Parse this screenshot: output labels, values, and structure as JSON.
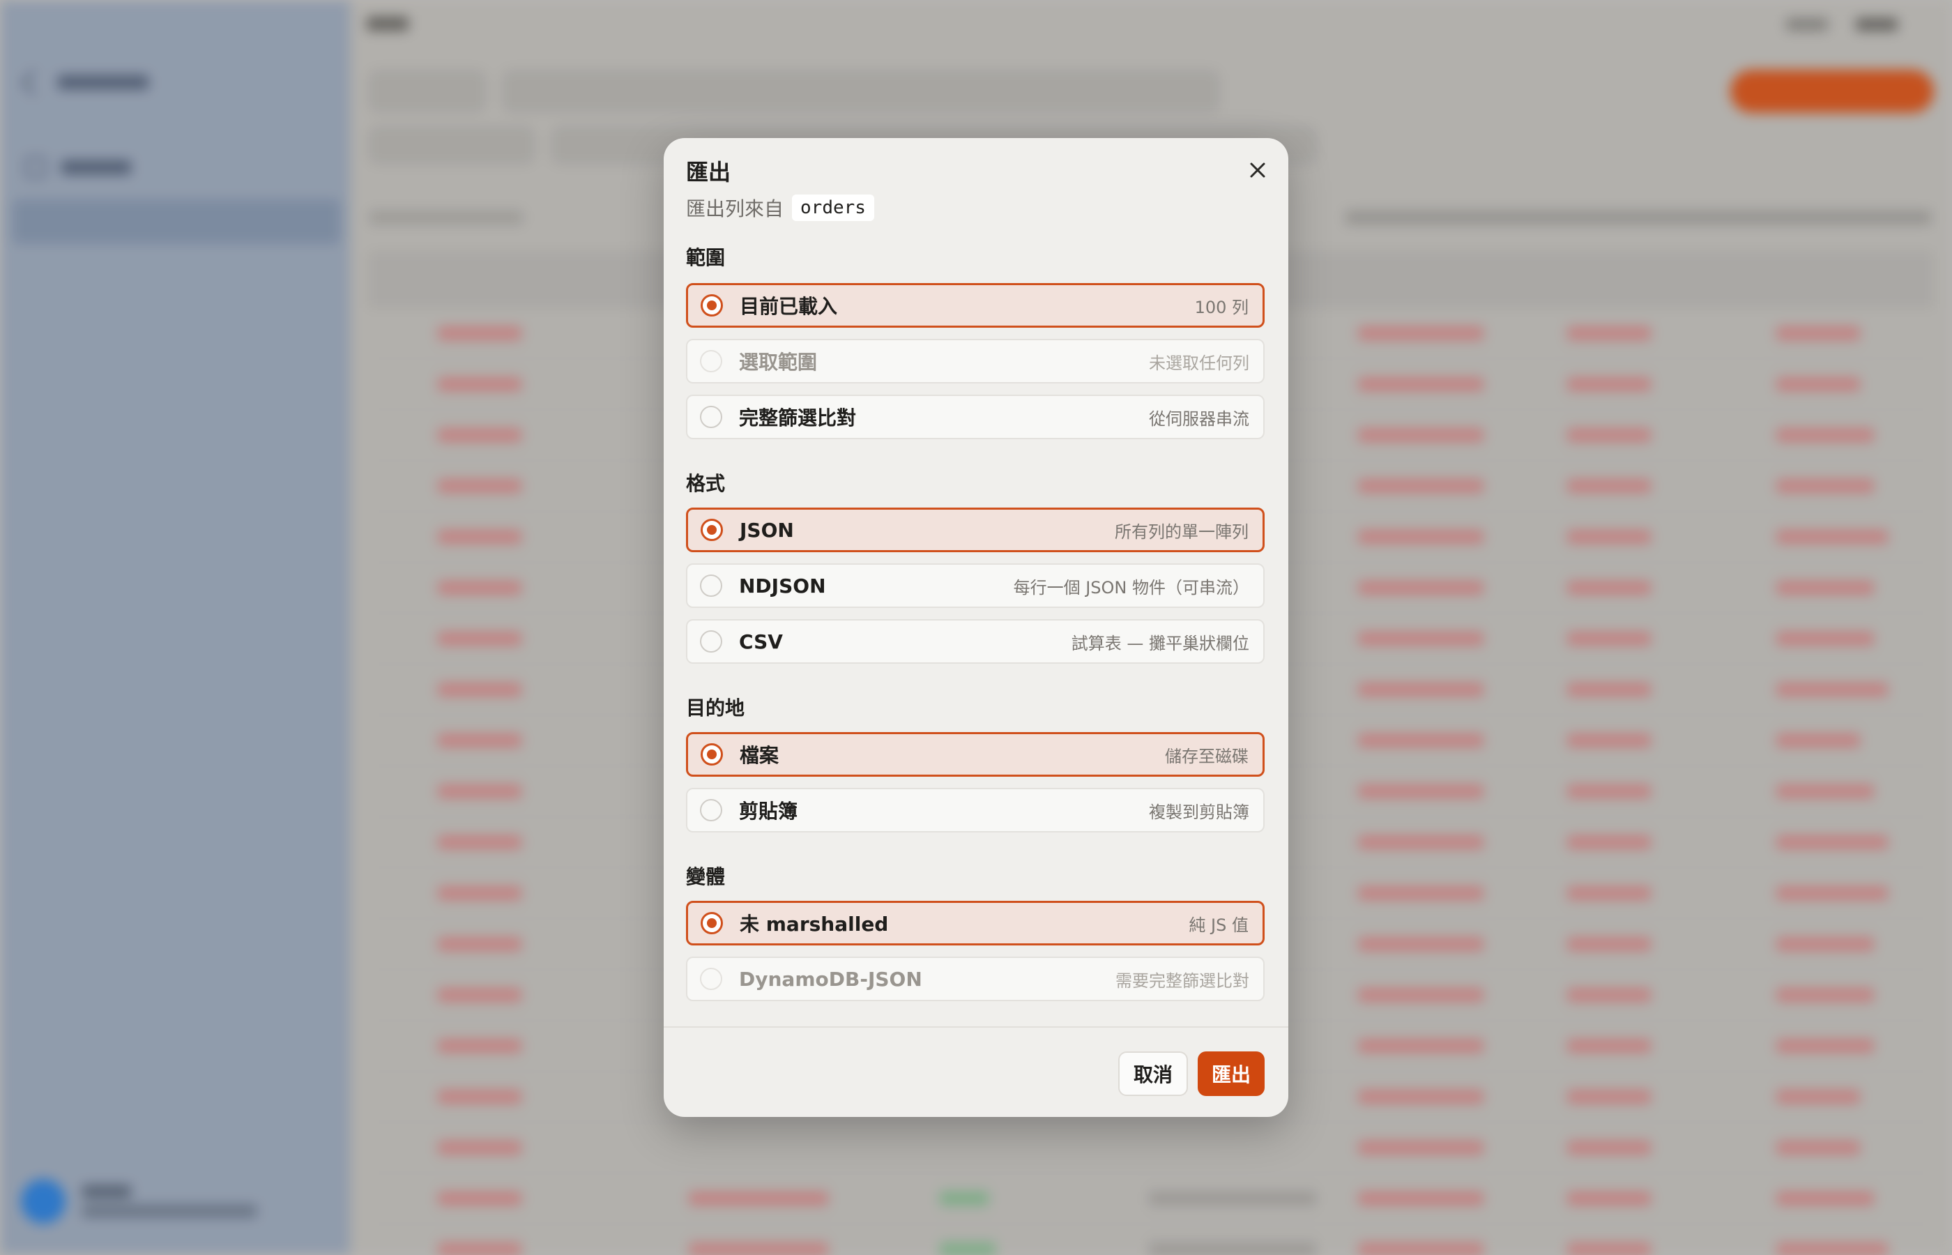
{
  "dialog": {
    "title": "匯出",
    "subtitle": "匯出列來自",
    "table_name": "orders",
    "cancel_label": "取消",
    "export_label": "匯出"
  },
  "sections": {
    "range": {
      "label": "範圍",
      "options": [
        {
          "label": "目前已載入",
          "hint": "100 列",
          "selected": true,
          "disabled": false
        },
        {
          "label": "選取範圍",
          "hint": "未選取任何列",
          "selected": false,
          "disabled": true
        },
        {
          "label": "完整篩選比對",
          "hint": "從伺服器串流",
          "selected": false,
          "disabled": false
        }
      ]
    },
    "format": {
      "label": "格式",
      "options": [
        {
          "label": "JSON",
          "hint": "所有列的單一陣列",
          "selected": true,
          "disabled": false
        },
        {
          "label": "NDJSON",
          "hint": "每行一個 JSON 物件（可串流）",
          "selected": false,
          "disabled": false
        },
        {
          "label": "CSV",
          "hint": "試算表 — 攤平巢狀欄位",
          "selected": false,
          "disabled": false
        }
      ]
    },
    "destination": {
      "label": "目的地",
      "options": [
        {
          "label": "檔案",
          "hint": "儲存至磁碟",
          "selected": true,
          "disabled": false
        },
        {
          "label": "剪貼簿",
          "hint": "複製到剪貼簿",
          "selected": false,
          "disabled": false
        }
      ]
    },
    "variant": {
      "label": "變體",
      "options": [
        {
          "label": "未 marshalled",
          "hint": "純 JS 值",
          "selected": true,
          "disabled": false
        },
        {
          "label": "DynamoDB-JSON",
          "hint": "需要完整篩選比對",
          "selected": false,
          "disabled": true
        }
      ]
    }
  },
  "colors": {
    "accent": "#d0501c",
    "selected_bg": "#f2e2dc",
    "modal_bg": "#f0efec"
  },
  "icons": {
    "close": "close-icon"
  }
}
